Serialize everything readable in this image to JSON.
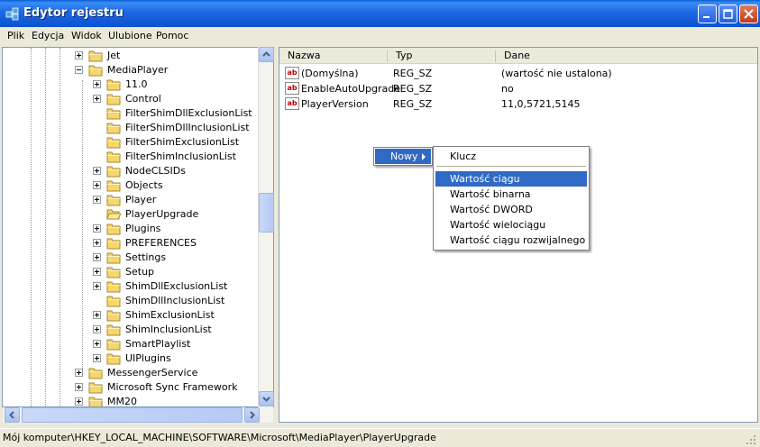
{
  "window": {
    "title": "Edytor rejestru"
  },
  "menu": [
    "Plik",
    "Edycja",
    "Widok",
    "Ulubione",
    "Pomoc"
  ],
  "tree": [
    {
      "label": "Jet",
      "exp": "plus",
      "level": 0
    },
    {
      "label": "MediaPlayer",
      "exp": "minus",
      "level": 0
    },
    {
      "label": "11.0",
      "exp": "plus",
      "level": 1
    },
    {
      "label": "Control",
      "exp": "plus",
      "level": 1
    },
    {
      "label": "FilterShimDllExclusionList",
      "exp": "",
      "level": 1
    },
    {
      "label": "FilterShimDllInclusionList",
      "exp": "",
      "level": 1
    },
    {
      "label": "FilterShimExclusionList",
      "exp": "",
      "level": 1
    },
    {
      "label": "FilterShimInclusionList",
      "exp": "",
      "level": 1
    },
    {
      "label": "NodeCLSIDs",
      "exp": "plus",
      "level": 1
    },
    {
      "label": "Objects",
      "exp": "plus",
      "level": 1
    },
    {
      "label": "Player",
      "exp": "plus",
      "level": 1
    },
    {
      "label": "PlayerUpgrade",
      "exp": "",
      "level": 1,
      "open": true
    },
    {
      "label": "Plugins",
      "exp": "plus",
      "level": 1
    },
    {
      "label": "PREFERENCES",
      "exp": "plus",
      "level": 1
    },
    {
      "label": "Settings",
      "exp": "plus",
      "level": 1
    },
    {
      "label": "Setup",
      "exp": "plus",
      "level": 1
    },
    {
      "label": "ShimDllExclusionList",
      "exp": "plus",
      "level": 1
    },
    {
      "label": "ShimDllInclusionList",
      "exp": "",
      "level": 1
    },
    {
      "label": "ShimExclusionList",
      "exp": "plus",
      "level": 1
    },
    {
      "label": "ShimInclusionList",
      "exp": "plus",
      "level": 1
    },
    {
      "label": "SmartPlaylist",
      "exp": "plus",
      "level": 1
    },
    {
      "label": "UIPlugins",
      "exp": "plus",
      "level": 1
    },
    {
      "label": "MessengerService",
      "exp": "plus",
      "level": 0
    },
    {
      "label": "Microsoft Sync Framework",
      "exp": "plus",
      "level": 0
    },
    {
      "label": "MM20",
      "exp": "plus",
      "level": 0
    }
  ],
  "columns": {
    "name": "Nazwa",
    "type": "Typ",
    "data": "Dane"
  },
  "values": [
    {
      "name": "(Domyślna)",
      "type": "REG_SZ",
      "data": "(wartość nie ustalona)"
    },
    {
      "name": "EnableAutoUpgrade",
      "type": "REG_SZ",
      "data": "no"
    },
    {
      "name": "PlayerVersion",
      "type": "REG_SZ",
      "data": "11,0,5721,5145"
    }
  ],
  "value_icon": "ab",
  "context_menu": {
    "label": "Nowy",
    "submenu": [
      "Klucz",
      "Wartość ciągu",
      "Wartość binarna",
      "Wartość DWORD",
      "Wartość wielociągu",
      "Wartość ciągu rozwijalnego"
    ],
    "highlighted": "Wartość ciągu"
  },
  "status": "Mój komputer\\HKEY_LOCAL_MACHINE\\SOFTWARE\\Microsoft\\MediaPlayer\\PlayerUpgrade",
  "icons": {
    "app": "registry-editor-icon",
    "folder": "folder-icon"
  },
  "colors": {
    "titlebar": "#0b52d0",
    "highlight": "#316ac5",
    "folder": "#f5d76e"
  }
}
